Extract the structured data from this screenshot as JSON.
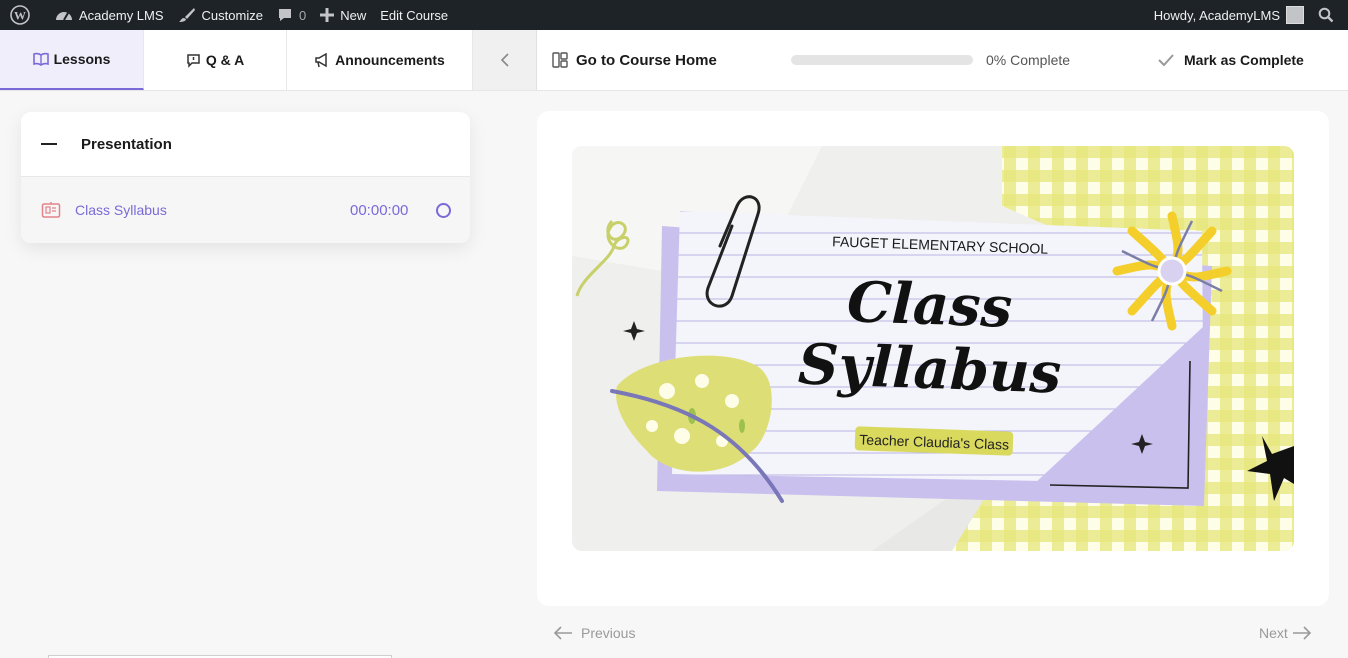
{
  "admin_bar": {
    "site_name": "Academy LMS",
    "customize": "Customize",
    "comments_count": "0",
    "new_label": "New",
    "edit_course": "Edit Course",
    "howdy": "Howdy, AcademyLMS"
  },
  "header": {
    "tabs": [
      {
        "label": "Lessons",
        "icon": "book-icon",
        "active": true
      },
      {
        "label": "Q & A",
        "icon": "qa-icon",
        "active": false
      },
      {
        "label": "Announcements",
        "icon": "megaphone-icon",
        "active": false
      }
    ],
    "go_home": "Go to Course Home",
    "progress_value": 0,
    "progress_text": "0% Complete",
    "mark_complete": "Mark as Complete"
  },
  "sidebar": {
    "topic_title": "Presentation",
    "lessons": [
      {
        "title": "Class Syllabus",
        "duration": "00:00:00",
        "icon": "presentation-icon",
        "completed": false
      }
    ]
  },
  "slide": {
    "school": "FAUGET ELEMENTARY SCHOOL",
    "title_line1": "Class",
    "title_line2": "Syllabus",
    "subtitle": "Teacher Claudia's Class"
  },
  "nav": {
    "previous": "Previous",
    "next": "Next"
  },
  "colors": {
    "accent": "#7a6ad8",
    "admin_bar": "#1d2327",
    "slide_lavender": "#c9c0ee",
    "slide_yellow": "#e6e77c"
  }
}
